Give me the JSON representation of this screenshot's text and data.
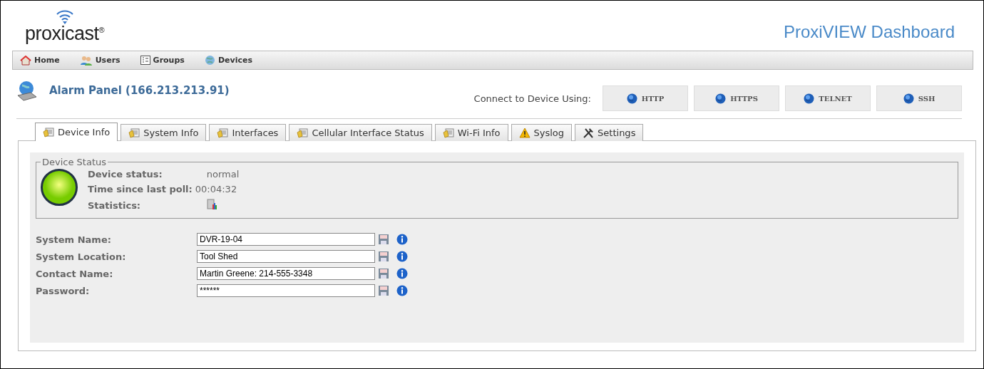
{
  "header": {
    "logo": "proxicast",
    "logo_mark": "®",
    "title": "ProxiVIEW Dashboard"
  },
  "nav": [
    {
      "label": "Home",
      "kind": "home"
    },
    {
      "label": "Users",
      "kind": "users"
    },
    {
      "label": "Groups",
      "kind": "groups"
    },
    {
      "label": "Devices",
      "kind": "devices"
    }
  ],
  "device": {
    "title": "Alarm Panel (166.213.213.91)",
    "connect_label": "Connect to Device Using:",
    "connect_buttons": [
      "HTTP",
      "HTTPS",
      "TELNET",
      "SSH"
    ]
  },
  "tabs": [
    {
      "label": "Device Info",
      "kind": "doc",
      "selected": true
    },
    {
      "label": "System Info",
      "kind": "doc",
      "selected": false
    },
    {
      "label": "Interfaces",
      "kind": "doc",
      "selected": false
    },
    {
      "label": "Cellular Interface Status",
      "kind": "doc",
      "selected": false
    },
    {
      "label": "Wi-Fi Info",
      "kind": "doc",
      "selected": false
    },
    {
      "label": "Syslog",
      "kind": "warning",
      "selected": false
    },
    {
      "label": "Settings",
      "kind": "tools",
      "selected": false
    }
  ],
  "device_status": {
    "legend": "Device Status",
    "color": "#77cc00",
    "rows": [
      {
        "label": "Device status:",
        "value": "normal",
        "kind": "text"
      },
      {
        "label": "Time since last poll:",
        "value": "00:04:32",
        "kind": "text"
      },
      {
        "label": "Statistics:",
        "kind": "stats"
      }
    ]
  },
  "fields": [
    {
      "label": "System Name:",
      "value": "DVR-19-04"
    },
    {
      "label": "System Location:",
      "value": "Tool Shed"
    },
    {
      "label": "Contact Name:",
      "value": "Martin Greene: 214-555-3348"
    },
    {
      "label": "Password:",
      "value": "******"
    }
  ]
}
